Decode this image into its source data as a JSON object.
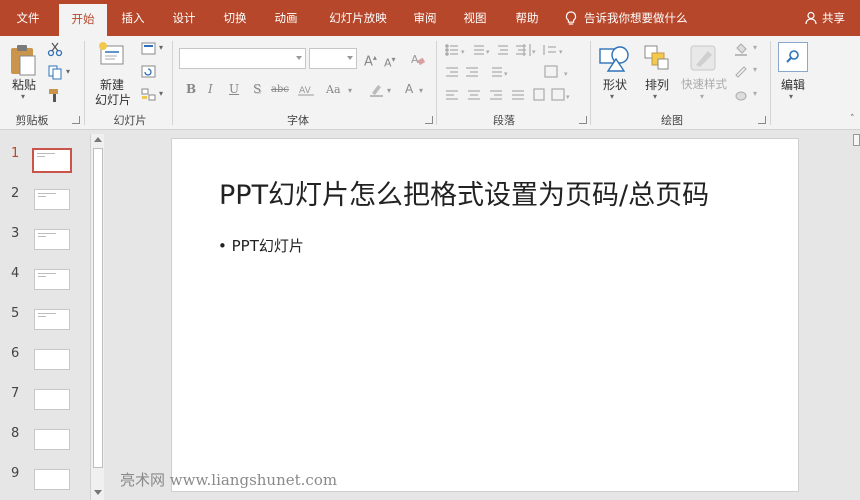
{
  "tabs": [
    {
      "label": "文件",
      "active": false
    },
    {
      "label": "开始",
      "active": true
    },
    {
      "label": "插入",
      "active": false
    },
    {
      "label": "设计",
      "active": false
    },
    {
      "label": "切换",
      "active": false
    },
    {
      "label": "动画",
      "active": false
    },
    {
      "label": "幻灯片放映",
      "active": false
    },
    {
      "label": "审阅",
      "active": false
    },
    {
      "label": "视图",
      "active": false
    },
    {
      "label": "帮助",
      "active": false
    }
  ],
  "tell_me": "告诉我你想要做什么",
  "share": "共享",
  "ribbon": {
    "clipboard": {
      "paste": "粘贴",
      "group": "剪贴板"
    },
    "slides": {
      "new_line1": "新建",
      "new_line2": "幻灯片",
      "group": "幻灯片"
    },
    "font": {
      "group": "字体",
      "font_name": "",
      "font_size": "",
      "bold": "B",
      "italic": "I",
      "underline": "U",
      "shadow": "S",
      "strike": "abc",
      "case": "Aa",
      "grow": "A",
      "shrink": "A"
    },
    "paragraph": {
      "group": "段落"
    },
    "drawing": {
      "shapes": "形状",
      "arrange": "排列",
      "quick_styles": "快速样式",
      "group": "绘图"
    },
    "editing": {
      "label": "编辑"
    }
  },
  "slides": [
    {
      "num": "1",
      "selected": true
    },
    {
      "num": "2",
      "selected": false
    },
    {
      "num": "3",
      "selected": false
    },
    {
      "num": "4",
      "selected": false
    },
    {
      "num": "5",
      "selected": false
    },
    {
      "num": "6",
      "selected": false
    },
    {
      "num": "7",
      "selected": false
    },
    {
      "num": "8",
      "selected": false
    },
    {
      "num": "9",
      "selected": false
    }
  ],
  "current_slide": {
    "title": "PPT幻灯片怎么把格式设置为页码/总页码",
    "bullet": "• PPT幻灯片"
  },
  "watermark": "亮术网 www.liangshunet.com",
  "colors": {
    "accent": "#b7472a",
    "ribbon_bg": "#f3f3f3",
    "selected_thumb": "#c9544a"
  }
}
